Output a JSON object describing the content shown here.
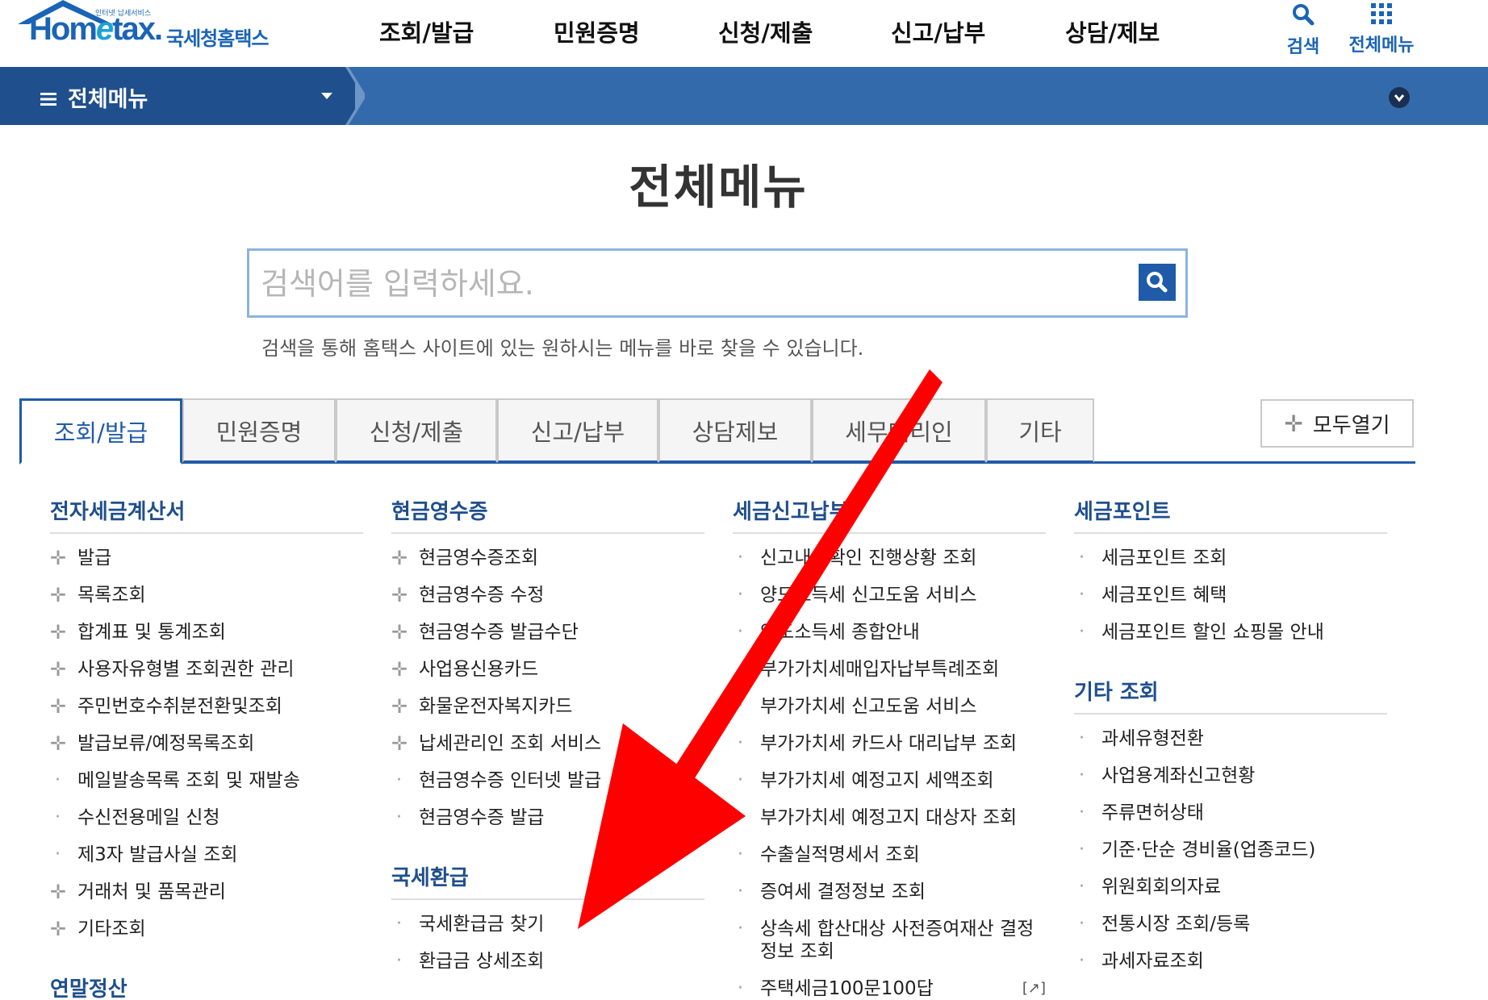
{
  "header": {
    "logo_small": "인터넷 납세서비스",
    "logo_main_a": "Hom",
    "logo_main_e": "e",
    "logo_main_b": "tax.",
    "logo_kr": "국세청홈택스",
    "gnb": [
      "조회/발급",
      "민원증명",
      "신청/제출",
      "신고/납부",
      "상담/제보"
    ],
    "search_label": "검색",
    "allmenu_label": "전체메뉴"
  },
  "navbar": {
    "menu_label": "전체메뉴"
  },
  "page": {
    "title": "전체메뉴",
    "search_placeholder": "검색어를 입력하세요.",
    "search_hint": "검색을 통해 홈택스 사이트에 있는 원하시는 메뉴를 바로 찾을 수 있습니다.",
    "tabs": [
      "조회/발급",
      "민원증명",
      "신청/제출",
      "신고/납부",
      "상담제보",
      "세무대리인",
      "기타"
    ],
    "active_tab": "조회/발급",
    "expand_all": "모두열기"
  },
  "columns": [
    {
      "sections": [
        {
          "title": "전자세금계산서",
          "items": [
            {
              "mark": "plus",
              "text": "발급"
            },
            {
              "mark": "plus",
              "text": "목록조회"
            },
            {
              "mark": "plus",
              "text": "합계표 및 통계조회"
            },
            {
              "mark": "plus",
              "text": "사용자유형별 조회권한 관리"
            },
            {
              "mark": "plus",
              "text": "주민번호수취분전환및조회"
            },
            {
              "mark": "plus",
              "text": "발급보류/예정목록조회"
            },
            {
              "mark": "dot",
              "text": "메일발송목록 조회 및 재발송"
            },
            {
              "mark": "dot",
              "text": "수신전용메일 신청"
            },
            {
              "mark": "dot",
              "text": "제3자 발급사실 조회"
            },
            {
              "mark": "plus",
              "text": "거래처 및 품목관리"
            },
            {
              "mark": "plus",
              "text": "기타조회"
            }
          ]
        },
        {
          "title": "연말정산",
          "items": []
        }
      ]
    },
    {
      "sections": [
        {
          "title": "현금영수증",
          "items": [
            {
              "mark": "plus",
              "text": "현금영수증조회"
            },
            {
              "mark": "plus",
              "text": "현금영수증 수정"
            },
            {
              "mark": "plus",
              "text": "현금영수증 발급수단"
            },
            {
              "mark": "plus",
              "text": "사업용신용카드"
            },
            {
              "mark": "plus",
              "text": "화물운전자복지카드"
            },
            {
              "mark": "plus",
              "text": "납세관리인 조회 서비스"
            },
            {
              "mark": "dot",
              "text": "현금영수증 인터넷 발급"
            },
            {
              "mark": "dot",
              "text": "현금영수증 발급"
            }
          ]
        },
        {
          "title": "국세환급",
          "items": [
            {
              "mark": "dot",
              "text": "국세환급금 찾기"
            },
            {
              "mark": "dot",
              "text": "환급금 상세조회"
            }
          ]
        }
      ]
    },
    {
      "sections": [
        {
          "title": "세금신고납부",
          "items": [
            {
              "mark": "dot",
              "text": "신고내용확인 진행상황 조회"
            },
            {
              "mark": "dot",
              "text": "양도소득세 신고도움 서비스"
            },
            {
              "mark": "dot",
              "text": "양도소득세 종합안내"
            },
            {
              "mark": "dot",
              "text": "부가가치세매입자납부특례조회"
            },
            {
              "mark": "dot",
              "text": "부가가치세 신고도움 서비스"
            },
            {
              "mark": "dot",
              "text": "부가가치세 카드사 대리납부 조회"
            },
            {
              "mark": "dot",
              "text": "부가가치세 예정고지 세액조회"
            },
            {
              "mark": "dot",
              "text": "부가가치세 예정고지 대상자 조회"
            },
            {
              "mark": "dot",
              "text": "수출실적명세서 조회"
            },
            {
              "mark": "dot",
              "text": "증여세 결정정보 조회"
            },
            {
              "mark": "dot",
              "text": "상속세 합산대상 사전증여재산 결정정보 조회"
            },
            {
              "mark": "dot",
              "text": "주택세금100문100답",
              "external": "[↗]"
            }
          ]
        }
      ]
    },
    {
      "sections": [
        {
          "title": "세금포인트",
          "items": [
            {
              "mark": "dot",
              "text": "세금포인트 조회"
            },
            {
              "mark": "dot",
              "text": "세금포인트 혜택"
            },
            {
              "mark": "dot",
              "text": "세금포인트 할인 쇼핑몰 안내"
            }
          ]
        },
        {
          "title": "기타 조회",
          "items": [
            {
              "mark": "dot",
              "text": "과세유형전환"
            },
            {
              "mark": "dot",
              "text": "사업용계좌신고현황"
            },
            {
              "mark": "dot",
              "text": "주류면허상태"
            },
            {
              "mark": "dot",
              "text": "기준·단순 경비율(업종코드)"
            },
            {
              "mark": "dot",
              "text": "위원회회의자료"
            },
            {
              "mark": "dot",
              "text": "전통시장 조회/등록"
            },
            {
              "mark": "dot",
              "text": "과세자료조회"
            }
          ]
        }
      ]
    }
  ],
  "colors": {
    "brand": "#1b64b5",
    "navbar": "#336aac",
    "navbar_dark": "#1f4f8d",
    "section_title": "#1f4f8d",
    "annotation_arrow": "#ff0000"
  },
  "icons": {
    "search": "search-icon",
    "allmenu": "grid-icon",
    "hamburger": "hamburger-icon",
    "expand": "plus-icon",
    "collapse_down": "chevron-down-icon"
  }
}
